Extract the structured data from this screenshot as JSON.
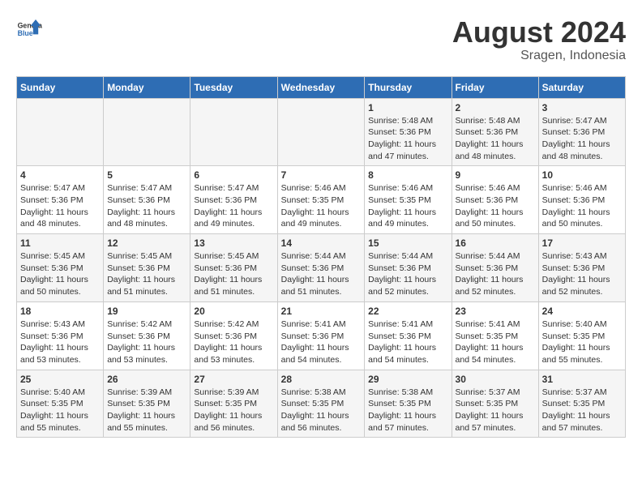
{
  "header": {
    "logo_general": "General",
    "logo_blue": "Blue",
    "month_year": "August 2024",
    "location": "Sragen, Indonesia"
  },
  "calendar": {
    "days_of_week": [
      "Sunday",
      "Monday",
      "Tuesday",
      "Wednesday",
      "Thursday",
      "Friday",
      "Saturday"
    ],
    "weeks": [
      [
        {
          "day": "",
          "info": ""
        },
        {
          "day": "",
          "info": ""
        },
        {
          "day": "",
          "info": ""
        },
        {
          "day": "",
          "info": ""
        },
        {
          "day": "1",
          "info": "Sunrise: 5:48 AM\nSunset: 5:36 PM\nDaylight: 11 hours and 47 minutes."
        },
        {
          "day": "2",
          "info": "Sunrise: 5:48 AM\nSunset: 5:36 PM\nDaylight: 11 hours and 48 minutes."
        },
        {
          "day": "3",
          "info": "Sunrise: 5:47 AM\nSunset: 5:36 PM\nDaylight: 11 hours and 48 minutes."
        }
      ],
      [
        {
          "day": "4",
          "info": "Sunrise: 5:47 AM\nSunset: 5:36 PM\nDaylight: 11 hours and 48 minutes."
        },
        {
          "day": "5",
          "info": "Sunrise: 5:47 AM\nSunset: 5:36 PM\nDaylight: 11 hours and 48 minutes."
        },
        {
          "day": "6",
          "info": "Sunrise: 5:47 AM\nSunset: 5:36 PM\nDaylight: 11 hours and 49 minutes."
        },
        {
          "day": "7",
          "info": "Sunrise: 5:46 AM\nSunset: 5:35 PM\nDaylight: 11 hours and 49 minutes."
        },
        {
          "day": "8",
          "info": "Sunrise: 5:46 AM\nSunset: 5:35 PM\nDaylight: 11 hours and 49 minutes."
        },
        {
          "day": "9",
          "info": "Sunrise: 5:46 AM\nSunset: 5:36 PM\nDaylight: 11 hours and 50 minutes."
        },
        {
          "day": "10",
          "info": "Sunrise: 5:46 AM\nSunset: 5:36 PM\nDaylight: 11 hours and 50 minutes."
        }
      ],
      [
        {
          "day": "11",
          "info": "Sunrise: 5:45 AM\nSunset: 5:36 PM\nDaylight: 11 hours and 50 minutes."
        },
        {
          "day": "12",
          "info": "Sunrise: 5:45 AM\nSunset: 5:36 PM\nDaylight: 11 hours and 51 minutes."
        },
        {
          "day": "13",
          "info": "Sunrise: 5:45 AM\nSunset: 5:36 PM\nDaylight: 11 hours and 51 minutes."
        },
        {
          "day": "14",
          "info": "Sunrise: 5:44 AM\nSunset: 5:36 PM\nDaylight: 11 hours and 51 minutes."
        },
        {
          "day": "15",
          "info": "Sunrise: 5:44 AM\nSunset: 5:36 PM\nDaylight: 11 hours and 52 minutes."
        },
        {
          "day": "16",
          "info": "Sunrise: 5:44 AM\nSunset: 5:36 PM\nDaylight: 11 hours and 52 minutes."
        },
        {
          "day": "17",
          "info": "Sunrise: 5:43 AM\nSunset: 5:36 PM\nDaylight: 11 hours and 52 minutes."
        }
      ],
      [
        {
          "day": "18",
          "info": "Sunrise: 5:43 AM\nSunset: 5:36 PM\nDaylight: 11 hours and 53 minutes."
        },
        {
          "day": "19",
          "info": "Sunrise: 5:42 AM\nSunset: 5:36 PM\nDaylight: 11 hours and 53 minutes."
        },
        {
          "day": "20",
          "info": "Sunrise: 5:42 AM\nSunset: 5:36 PM\nDaylight: 11 hours and 53 minutes."
        },
        {
          "day": "21",
          "info": "Sunrise: 5:41 AM\nSunset: 5:36 PM\nDaylight: 11 hours and 54 minutes."
        },
        {
          "day": "22",
          "info": "Sunrise: 5:41 AM\nSunset: 5:36 PM\nDaylight: 11 hours and 54 minutes."
        },
        {
          "day": "23",
          "info": "Sunrise: 5:41 AM\nSunset: 5:35 PM\nDaylight: 11 hours and 54 minutes."
        },
        {
          "day": "24",
          "info": "Sunrise: 5:40 AM\nSunset: 5:35 PM\nDaylight: 11 hours and 55 minutes."
        }
      ],
      [
        {
          "day": "25",
          "info": "Sunrise: 5:40 AM\nSunset: 5:35 PM\nDaylight: 11 hours and 55 minutes."
        },
        {
          "day": "26",
          "info": "Sunrise: 5:39 AM\nSunset: 5:35 PM\nDaylight: 11 hours and 55 minutes."
        },
        {
          "day": "27",
          "info": "Sunrise: 5:39 AM\nSunset: 5:35 PM\nDaylight: 11 hours and 56 minutes."
        },
        {
          "day": "28",
          "info": "Sunrise: 5:38 AM\nSunset: 5:35 PM\nDaylight: 11 hours and 56 minutes."
        },
        {
          "day": "29",
          "info": "Sunrise: 5:38 AM\nSunset: 5:35 PM\nDaylight: 11 hours and 57 minutes."
        },
        {
          "day": "30",
          "info": "Sunrise: 5:37 AM\nSunset: 5:35 PM\nDaylight: 11 hours and 57 minutes."
        },
        {
          "day": "31",
          "info": "Sunrise: 5:37 AM\nSunset: 5:35 PM\nDaylight: 11 hours and 57 minutes."
        }
      ]
    ]
  }
}
